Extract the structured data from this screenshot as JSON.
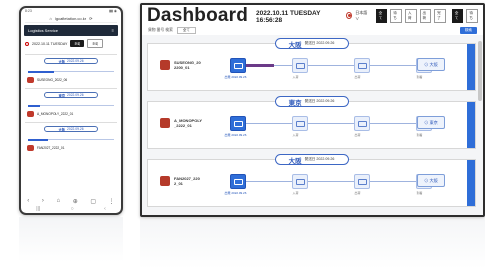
{
  "phone": {
    "status_time": "8:23",
    "status_icons": "▮▮ ◉",
    "url": "lgcafietation.co.kr",
    "header_title": "Logistics Service",
    "datetime": "2022.10.11 TUESDAY",
    "btn_dark": "조회",
    "btn_light": "조회",
    "cards": [
      {
        "city": "大阪",
        "date": "2022.09.26",
        "device": "SUSEONG_2022_06"
      },
      {
        "city": "東京",
        "date": "2022.09.26",
        "device": "A_MONOPOLY_2222_01"
      },
      {
        "city": "大阪",
        "date": "2022.09.26",
        "device": "FAN2027_2222_01"
      }
    ],
    "nav_icons": [
      "‹",
      "›",
      "⌂",
      "⊕",
      "▢",
      "⋮"
    ],
    "home_icons": [
      "|||",
      "○",
      "‹"
    ]
  },
  "dashboard": {
    "title": "Dashboard",
    "datetime": "2022.10.11 TUESDAY 16:56:28",
    "lang": "日本語 ∨",
    "toolbar": [
      "全て",
      "待ち",
      "入荷",
      "出荷",
      "完了",
      "全て",
      "待ち"
    ],
    "filter_label": "貨物 番号 検索",
    "filter_value": "全て",
    "action_button": "検索",
    "panels": [
      {
        "city": "大阪",
        "info": "発送日 2022.09.26",
        "device_line1": "SUSEONG_20",
        "device_line2": "2200_01",
        "destination": "⊙ 大阪"
      },
      {
        "city": "東京",
        "info": "発送日 2022.09.26",
        "device_line1": "A_MONOPOLY",
        "device_line2": "_2222_01",
        "destination": "⊙ 東京"
      },
      {
        "city": "大阪",
        "info": "発送日 2022.09.26",
        "device_line1": "FAN2027_220",
        "device_line2": "2_01",
        "destination": "⊙ 大阪"
      }
    ],
    "node_labels": [
      "出発 2022.09.26",
      "入荷",
      "出荷",
      "到着"
    ],
    "colors": {
      "accent": "#2f6ed8",
      "device": "#b53a2a",
      "route_progress": "#6b3a88"
    }
  }
}
